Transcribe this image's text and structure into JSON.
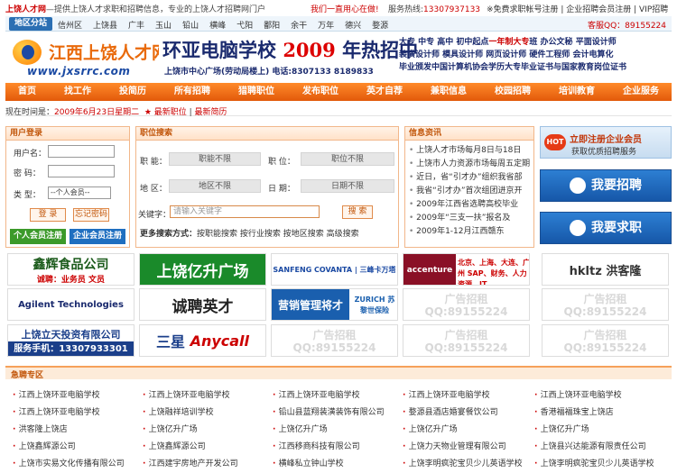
{
  "top": {
    "site_name": "上饶人才网",
    "tagline": "—提供上饶人才求职和招聘信息，专业的上饶人才招聘网门户",
    "home_link": "我们一直用心在做!",
    "hotline_label": "服务热线:",
    "hotline": "13307937133",
    "links": "※免费求职帐号注册 | 企业招聘会员注册 | VIP招聘"
  },
  "region": {
    "tag": "地区分站",
    "cities": [
      "信州区",
      "上饶县",
      "广丰",
      "玉山",
      "铅山",
      "横峰",
      "弋阳",
      "鄱阳",
      "余干",
      "万年",
      "德兴",
      "婺源"
    ],
    "qq": "客服QQ：89155224"
  },
  "logo": {
    "name": "江西上饶人才网",
    "url": "www.jxsrrc.com"
  },
  "banner": {
    "title_a": "环亚电脑学校",
    "title_year": "2009",
    "title_b": "年热招中",
    "sub": "上饶市中心广场(劳动局楼上) 电话:8307133  8189833"
  },
  "ads": {
    "r1a": "大专 中专 高中 初中起点",
    "r1b": "一年制大专",
    "r1c": "班 办公文秘 平面设计师",
    "r2": "装潢设计师 模具设计师 网页设计师 硬件工程师 会计电算化",
    "r3": "毕业颁发中国计算机协会学历大专毕业证书与国家教育岗位证书"
  },
  "nav": [
    "首页",
    "找工作",
    "投简历",
    "所有招聘",
    "猎聘职位",
    "发布职位",
    "英才自荐",
    "兼职信息",
    "校园招聘",
    "培训教育",
    "企业服务"
  ],
  "dateline": {
    "label": "现在时间是：",
    "date": "2009年6月23日星期二",
    "new_jobs": "★ 最新职位",
    "new_resumes": "最新简历"
  },
  "login": {
    "title": "用户登录",
    "username_label": "用户名：",
    "password_label": "密  码：",
    "type_label": "类  型：",
    "type_value": "--个人会员--",
    "login_btn": "登 录",
    "forgot_btn": "忘记密码",
    "reg_person": "个人会员注册",
    "reg_company": "企业会员注册"
  },
  "search": {
    "title": "职位搜索",
    "func_label": "职  能：",
    "func_value": "职能不限",
    "pos_label": "职  位：",
    "pos_value": "职位不限",
    "area_label": "地  区：",
    "area_value": "地区不限",
    "date_label": "日  期：",
    "date_value": "日期不限",
    "kw_label": "关键字：",
    "kw_placeholder": "请输入关键字",
    "btn": "搜 索",
    "more_label": "更多搜索方式：",
    "more_items": "按职能搜索  按行业搜索  按地区搜索  高级搜索"
  },
  "news": {
    "title": "信息资讯",
    "items": [
      "上饶人才市场每月8日与18日",
      "上饶市人力资源市场每周五定期",
      "近日，省“引才办”组织我省部",
      "我省“引才办”首次组团进京开",
      "2009年江西省选聘高校毕业",
      "2009年“三支一扶”报名及",
      "2009年1-12月江西赣东"
    ]
  },
  "side": {
    "register": "立即注册企业会员",
    "register_sub": "获取优质招聘服务",
    "hot": "HOT",
    "recruit": "我要招聘",
    "apply": "我要求职"
  },
  "logos": {
    "l1a": "鑫辉食品公司",
    "l1b": "诚聘：业务员 文员",
    "l2": "上饶亿升广场",
    "l3": "SANFENG COVANTA | 三峰卡万塔",
    "l4a": "accenture",
    "l4b": "北京、上海、大连、广州 SAP、财务、人力资源、IT",
    "l5": "hkltz 洪客隆",
    "l6": "Agilent Technologies",
    "l7": "诚聘英才",
    "l8a": "营销管理将才",
    "l8b": "ZURICH 苏黎世保险",
    "l9": "上饶立天投资有限公司",
    "l9b": "服务手机：13307933301",
    "l10a": "三星",
    "l10b": "Anycall",
    "ad_title": "广告招租",
    "ad_qq": "QQ:89155224"
  },
  "jobs": {
    "title": "急聘专区",
    "cols": [
      [
        "江西上饶环亚电脑学校",
        "江西上饶环亚电脑学校",
        "洪客隆上饶店",
        "上饶鑫辉源公司",
        "上饶市实易文化传播有限公司"
      ],
      [
        "江西上饶环亚电脑学校",
        "上饶融祥培训学校",
        "上饶亿升广场",
        "上饶鑫辉源公司",
        "江西建宇房地产开发公司"
      ],
      [
        "江西上饶环亚电脑学校",
        "铅山县蓝翔装潢装饰有限公司",
        "上饶亿升广场",
        "江西移商科技有限公司",
        "横峰私立钟山学校"
      ],
      [
        "江西上饶环亚电脑学校",
        "婺源县酒店婚宴餐饮公司",
        "上饶亿升广场",
        "上饶力天物业管理有限公司",
        "上饶李明疯驼宝贝少儿英语学校"
      ],
      [
        "江西上饶环亚电脑学校",
        "香港福福珠宝上饶店",
        "上饶亿升广场",
        "上饶县兴达能源有限责任公司",
        "上饶李明疯驼宝贝少儿英语学校"
      ]
    ]
  },
  "colors": {
    "brand_orange": "#e96a0b",
    "nav_orange": "#ff7a1a",
    "link_red": "#cc0000",
    "blue": "#1657a8"
  }
}
